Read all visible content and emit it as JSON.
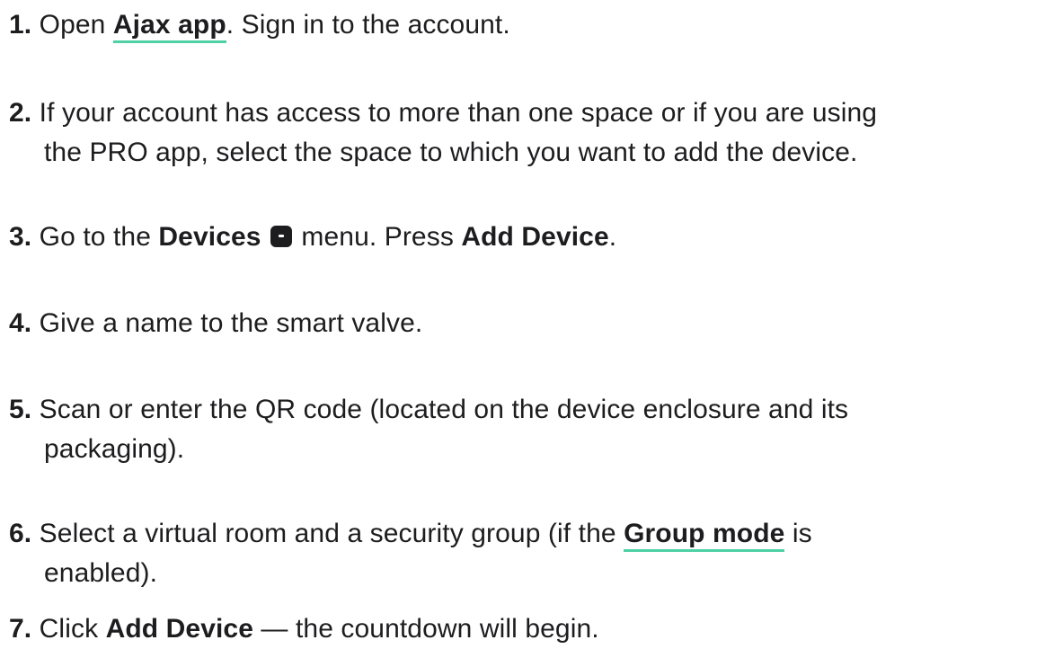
{
  "steps": [
    {
      "num": "1.",
      "t1": "Open ",
      "link": "Ajax app",
      "t2": ". Sign in to the account."
    },
    {
      "num": "2.",
      "line1": "If your account has access to more than one space or if you are using",
      "line2": "the PRO app, select the space to which you want to add the device."
    },
    {
      "num": "3.",
      "t1": "Go to the ",
      "b1": "Devices",
      "icon": "devices-icon",
      "t2": " menu. Press ",
      "b2": "Add Device",
      "t3": "."
    },
    {
      "num": "4.",
      "t1": "Give a name to the smart valve."
    },
    {
      "num": "5.",
      "line1": "Scan or enter the QR code (located on the device enclosure and its",
      "line2": "packaging)."
    },
    {
      "num": "6.",
      "t1": "Select a virtual room and a security group (if the ",
      "link": "Group mode",
      "t2": " is",
      "line2": "enabled)."
    },
    {
      "num": "7.",
      "t1": "Click ",
      "b1": "Add Device",
      "t2": " — the countdown will begin."
    }
  ],
  "colors": {
    "text": "#1d1d1f",
    "link_underline": "#4fd1a5"
  }
}
